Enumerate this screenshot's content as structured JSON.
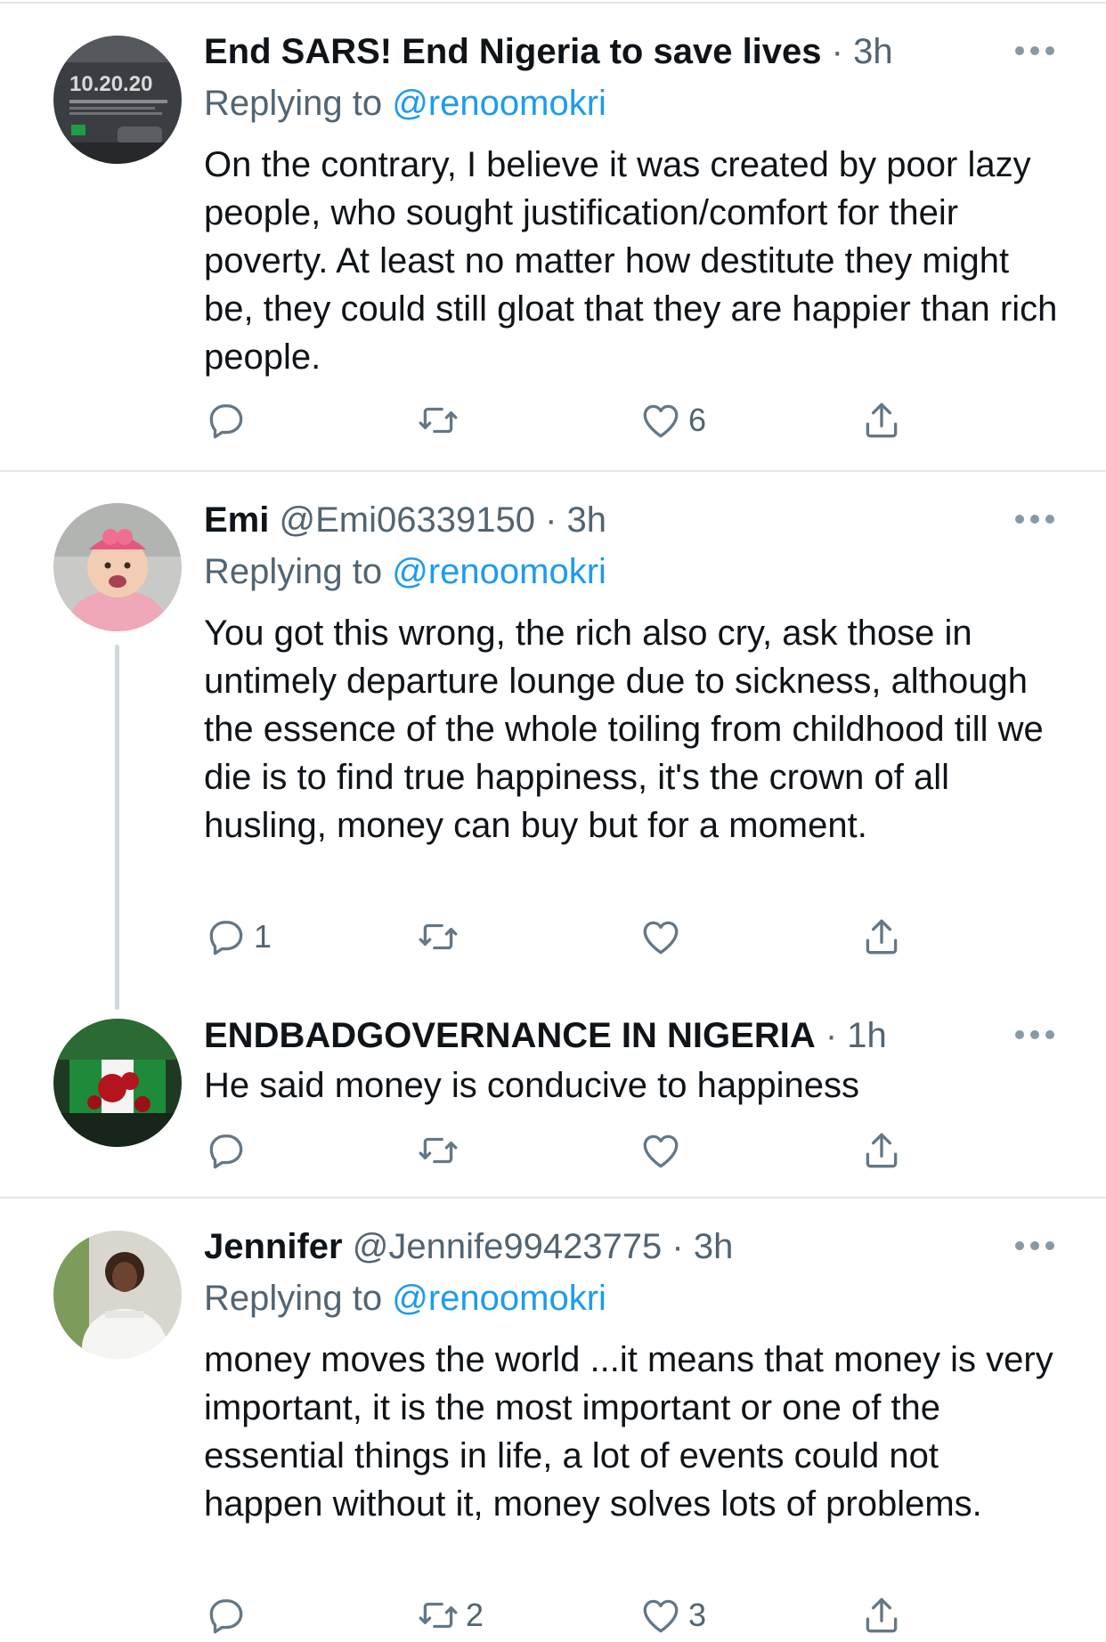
{
  "tweets": [
    {
      "name": "End SARS! End Nigeria to save lives",
      "handle": "",
      "time": "3h",
      "replying_label": "Replying to",
      "replying_to": "@renoomokri",
      "text": "On the contrary, I believe it was created by poor lazy people, who sought justification/comfort for their poverty. At least no matter how destitute they might be, they could still gloat that they are happier than rich people.",
      "reply_count": "",
      "retweet_count": "",
      "like_count": "6",
      "avatar_text": "10.20.20"
    },
    {
      "name": "Emi",
      "handle": "@Emi06339150",
      "time": "3h",
      "replying_label": "Replying to",
      "replying_to": "@renoomokri",
      "text": "You got this wrong, the rich also cry, ask those in untimely departure lounge due to sickness, although the essence of the whole toiling from childhood till we die is to find true happiness, it's the crown of all husling, money can buy but for a moment.",
      "reply_count": "1",
      "retweet_count": "",
      "like_count": ""
    },
    {
      "name": "ENDBADGOVERNANCE IN NIGERIA",
      "handle": "",
      "time": "1h",
      "text": "He said money is conducive to happiness",
      "reply_count": "",
      "retweet_count": "",
      "like_count": ""
    },
    {
      "name": "Jennifer",
      "handle": "@Jennife99423775",
      "time": "3h",
      "replying_label": "Replying to",
      "replying_to": "@renoomokri",
      "text": "money moves the world ...it means that money is very important, it is the most important or one of the essential things in life, a lot of events could not happen without it, money solves lots of problems.",
      "reply_count": "",
      "retweet_count": "2",
      "like_count": "3"
    }
  ],
  "dot_separator": "·",
  "colors": {
    "link": "#1d9bf0",
    "secondary": "#536471",
    "icon": "#657786",
    "divider": "#e1e8ed"
  },
  "icons": [
    "reply-icon",
    "retweet-icon",
    "like-icon",
    "share-icon",
    "more-icon"
  ]
}
